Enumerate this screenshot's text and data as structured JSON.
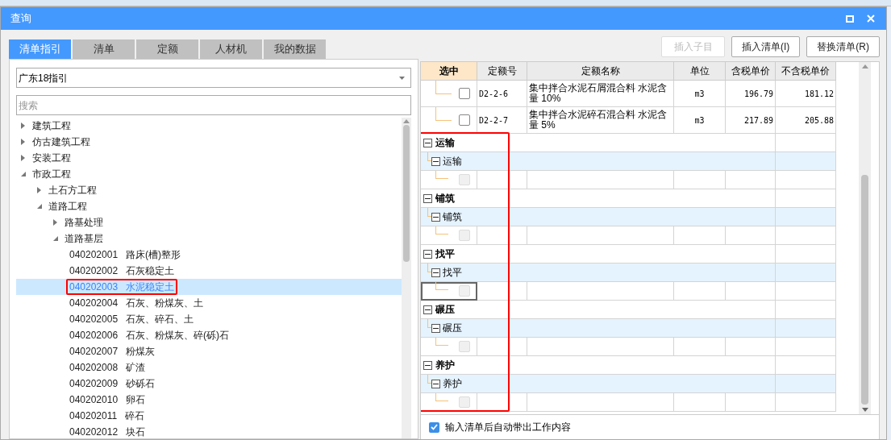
{
  "window": {
    "title": "查询"
  },
  "tabs": [
    {
      "label": "清单指引",
      "selected": true
    },
    {
      "label": "清单",
      "selected": false
    },
    {
      "label": "定额",
      "selected": false
    },
    {
      "label": "人材机",
      "selected": false
    },
    {
      "label": "我的数据",
      "selected": false
    }
  ],
  "buttons": [
    {
      "label": "插入子目",
      "disabled": true
    },
    {
      "label": "插入清单(I)",
      "disabled": false
    },
    {
      "label": "替换清单(R)",
      "disabled": false
    }
  ],
  "guide_select": {
    "value": "广东18指引"
  },
  "search": {
    "placeholder": "搜索"
  },
  "tree": [
    {
      "label": "建筑工程",
      "expanded": false
    },
    {
      "label": "仿古建筑工程",
      "expanded": false
    },
    {
      "label": "安装工程",
      "expanded": false
    },
    {
      "label": "市政工程",
      "expanded": true,
      "children": [
        {
          "label": "土石方工程",
          "expanded": false
        },
        {
          "label": "道路工程",
          "expanded": true,
          "children": [
            {
              "label": "路基处理",
              "expanded": false
            },
            {
              "label": "道路基层",
              "expanded": true,
              "children": [
                {
                  "code": "040202001",
                  "name": "路床(槽)整形",
                  "selected": false,
                  "highlighted": false
                },
                {
                  "code": "040202002",
                  "name": "石灰稳定土",
                  "selected": false,
                  "highlighted": false
                },
                {
                  "code": "040202003",
                  "name": "水泥稳定土",
                  "selected": true,
                  "highlighted": true
                },
                {
                  "code": "040202004",
                  "name": "石灰、粉煤灰、土",
                  "selected": false,
                  "highlighted": false
                },
                {
                  "code": "040202005",
                  "name": "石灰、碎石、土",
                  "selected": false,
                  "highlighted": false
                },
                {
                  "code": "040202006",
                  "name": "石灰、粉煤灰、碎(砾)石",
                  "selected": false,
                  "highlighted": false
                },
                {
                  "code": "040202007",
                  "name": "粉煤灰",
                  "selected": false,
                  "highlighted": false
                },
                {
                  "code": "040202008",
                  "name": "矿渣",
                  "selected": false,
                  "highlighted": false
                },
                {
                  "code": "040202009",
                  "name": "砂砾石",
                  "selected": false,
                  "highlighted": false
                },
                {
                  "code": "040202010",
                  "name": "卵石",
                  "selected": false,
                  "highlighted": false
                },
                {
                  "code": "040202011",
                  "name": "碎石",
                  "selected": false,
                  "highlighted": false
                },
                {
                  "code": "040202012",
                  "name": "块石",
                  "selected": false,
                  "highlighted": false
                }
              ]
            }
          ]
        }
      ]
    }
  ],
  "table": {
    "columns": [
      "选中",
      "定额号",
      "定额名称",
      "单位",
      "含税单价",
      "不含税单价"
    ],
    "first_column_highlighted": true,
    "rows": [
      {
        "kind": "item",
        "checked": false,
        "code": "D2-2-6",
        "name": "集中拌合水泥石屑混合料 水泥含量 10%",
        "unit": "m3",
        "price_tax": "196.79",
        "price_notax": "181.12"
      },
      {
        "kind": "item",
        "checked": false,
        "code": "D2-2-7",
        "name": "集中拌合水泥碎石混合料 水泥含量 5%",
        "unit": "m3",
        "price_tax": "217.89",
        "price_notax": "205.88"
      },
      {
        "kind": "group",
        "label": "运输"
      },
      {
        "kind": "subgroup",
        "label": "运输"
      },
      {
        "kind": "empty",
        "focused": false
      },
      {
        "kind": "group",
        "label": "铺筑"
      },
      {
        "kind": "subgroup",
        "label": "铺筑"
      },
      {
        "kind": "empty",
        "focused": false
      },
      {
        "kind": "group",
        "label": "找平"
      },
      {
        "kind": "subgroup",
        "label": "找平"
      },
      {
        "kind": "empty",
        "focused": true
      },
      {
        "kind": "group",
        "label": "碾压"
      },
      {
        "kind": "subgroup",
        "label": "碾压"
      },
      {
        "kind": "empty",
        "focused": false
      },
      {
        "kind": "group",
        "label": "养护"
      },
      {
        "kind": "subgroup",
        "label": "养护"
      },
      {
        "kind": "empty",
        "focused": false
      }
    ]
  },
  "auto_option": {
    "label": "输入清单后自动带出工作内容",
    "checked": true
  }
}
